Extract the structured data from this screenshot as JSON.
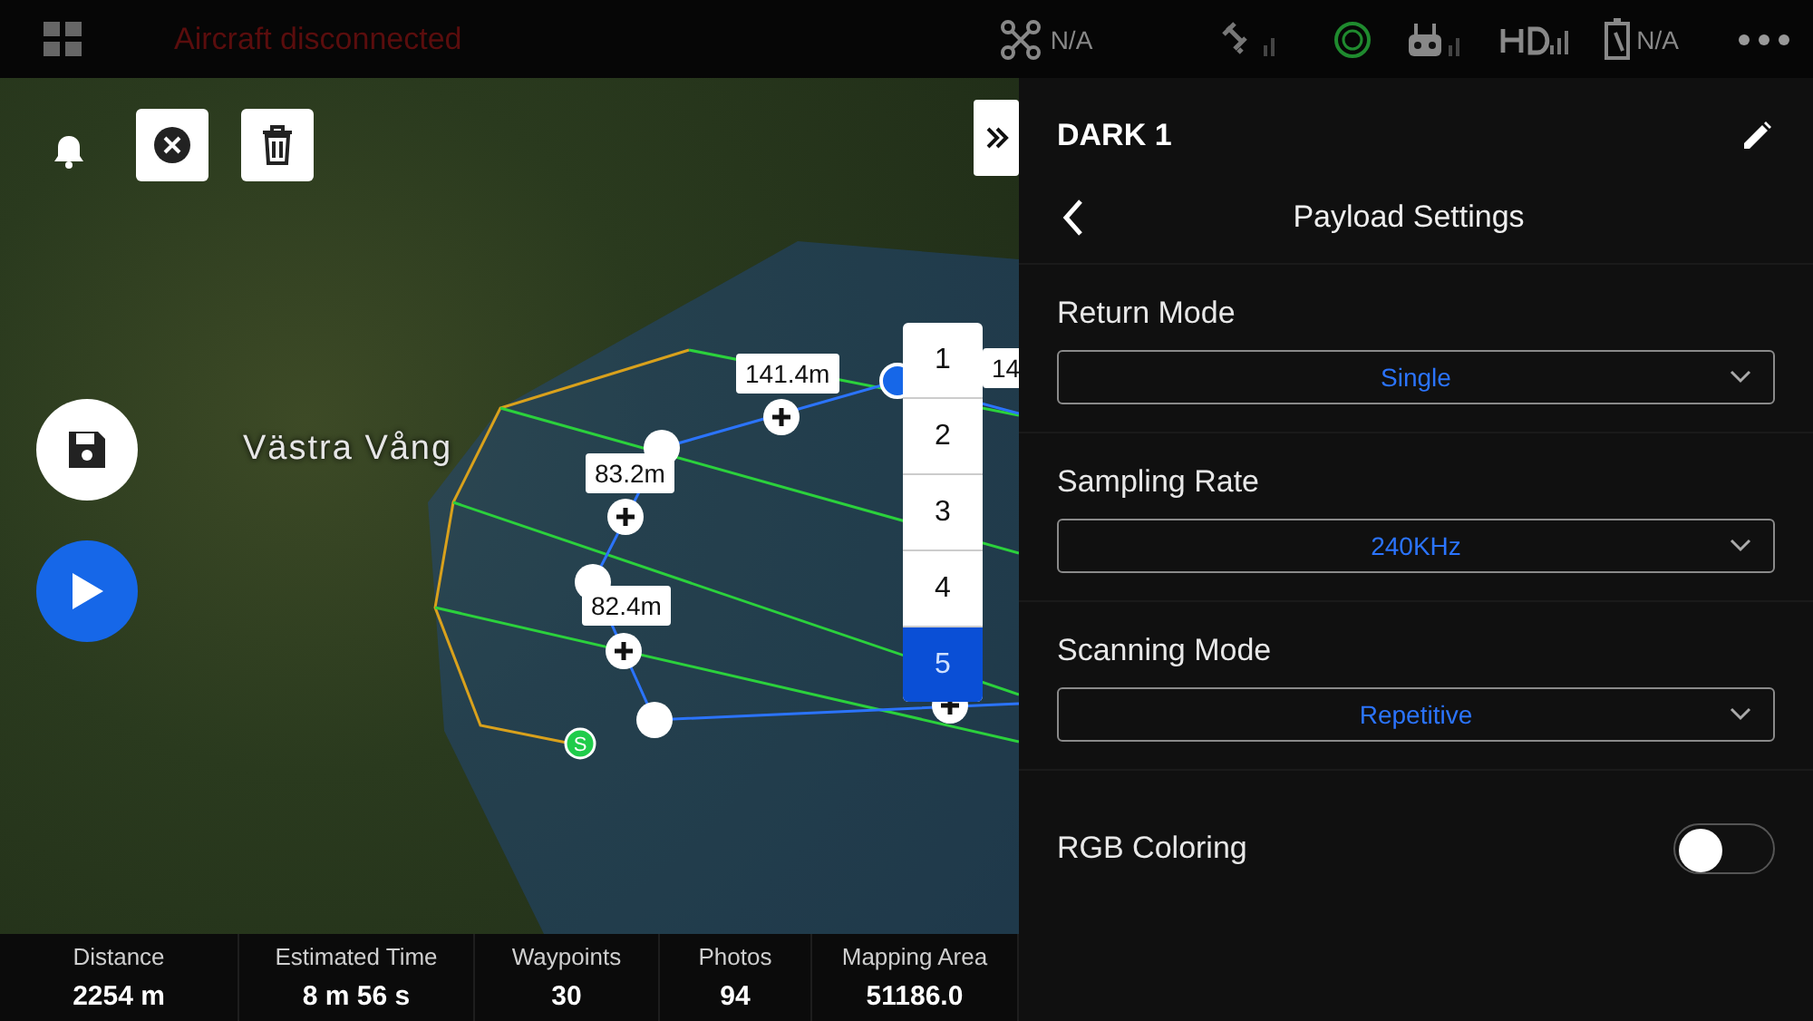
{
  "top_bar": {
    "status": "Aircraft disconnected",
    "drone_status": "N/A",
    "battery_status": "N/A"
  },
  "map": {
    "place_label": "Västra Vång",
    "distance_labels": [
      "141.4m",
      "83.2m",
      "82.4m",
      "14"
    ],
    "start_marker": "S"
  },
  "number_picker": [
    {
      "label": "1",
      "selected": false
    },
    {
      "label": "2",
      "selected": false
    },
    {
      "label": "3",
      "selected": false
    },
    {
      "label": "4",
      "selected": false
    },
    {
      "label": "5",
      "selected": true
    }
  ],
  "stats": [
    {
      "label": "Distance",
      "value": "2254 m"
    },
    {
      "label": "Estimated Time",
      "value": "8 m 56 s"
    },
    {
      "label": "Waypoints",
      "value": "30"
    },
    {
      "label": "Photos",
      "value": "94"
    },
    {
      "label": "Mapping Area",
      "value": "51186.0"
    }
  ],
  "panel": {
    "title": "DARK 1",
    "subtitle": "Payload Settings",
    "settings": [
      {
        "kind": "dropdown",
        "label": "Return Mode",
        "value": "Single"
      },
      {
        "kind": "dropdown",
        "label": "Sampling Rate",
        "value": "240KHz"
      },
      {
        "kind": "dropdown",
        "label": "Scanning Mode",
        "value": "Repetitive"
      },
      {
        "kind": "toggle",
        "label": "RGB Coloring",
        "on": false
      }
    ]
  }
}
